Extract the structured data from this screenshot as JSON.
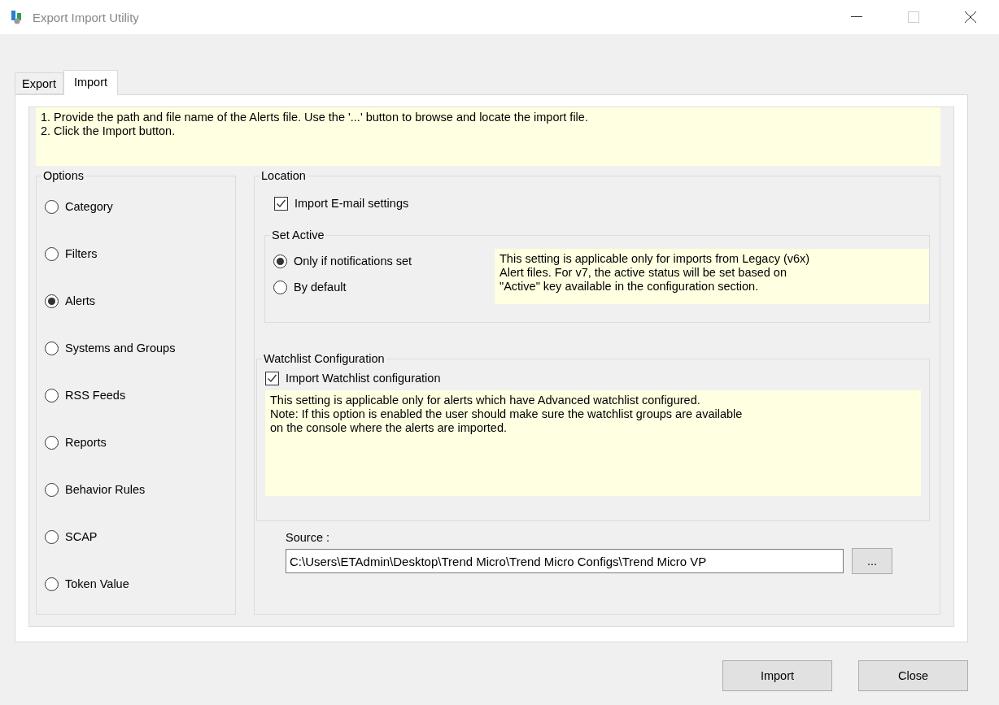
{
  "window": {
    "title": "Export Import Utility"
  },
  "tabs": [
    {
      "label": "Export",
      "selected": false
    },
    {
      "label": "Import",
      "selected": true
    }
  ],
  "instructions": [
    "1. Provide the path and file name of the Alerts file. Use the '...' button to browse and locate the import file.",
    "2. Click the Import button."
  ],
  "options": {
    "title": "Options",
    "items": [
      {
        "label": "Category",
        "selected": false
      },
      {
        "label": "Filters",
        "selected": false
      },
      {
        "label": "Alerts",
        "selected": true
      },
      {
        "label": "Systems and Groups",
        "selected": false
      },
      {
        "label": "RSS Feeds",
        "selected": false
      },
      {
        "label": "Reports",
        "selected": false
      },
      {
        "label": "Behavior Rules",
        "selected": false
      },
      {
        "label": "SCAP",
        "selected": false
      },
      {
        "label": "Token Value",
        "selected": false
      }
    ]
  },
  "location": {
    "title": "Location",
    "email": {
      "label": "Import E-mail settings",
      "checked": true
    },
    "set_active": {
      "title": "Set Active",
      "radios": [
        {
          "label": "Only if notifications set",
          "selected": true
        },
        {
          "label": "By default",
          "selected": false
        }
      ],
      "note": [
        "This setting is applicable only for imports from Legacy (v6x)",
        "Alert files. For v7, the active status will be set based on",
        "\"Active\" key available in the configuration section."
      ]
    },
    "watchlist": {
      "title": "Watchlist Configuration",
      "checkbox": {
        "label": "Import Watchlist configuration",
        "checked": true
      },
      "note": [
        "This setting is applicable only for alerts which have Advanced watchlist configured.",
        "Note: If this option is enabled the user should make sure the watchlist groups are available",
        "on the console where the alerts are imported."
      ]
    },
    "source": {
      "label": "Source :",
      "value": "C:\\Users\\ETAdmin\\Desktop\\Trend Micro\\Trend Micro Configs\\Trend Micro VP",
      "browse": "..."
    }
  },
  "buttons": [
    "Import",
    "Close"
  ]
}
